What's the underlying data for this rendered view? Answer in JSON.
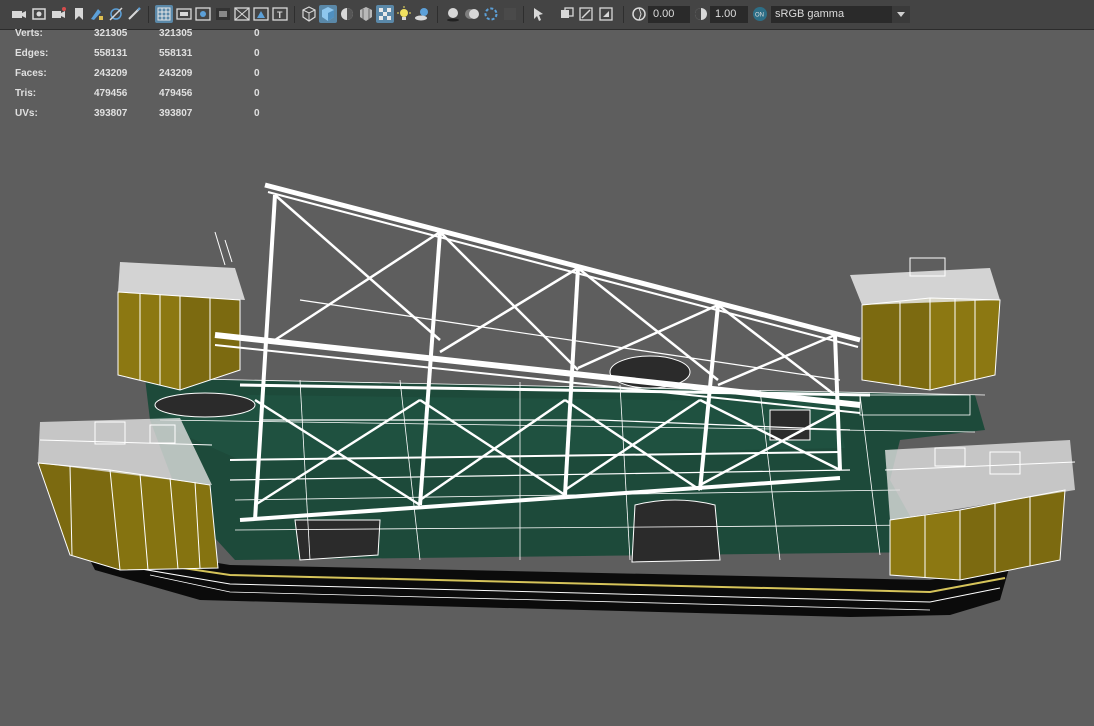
{
  "toolbar": {
    "icons": [
      "camera-icon",
      "camera-lock-icon",
      "camera-attributes-icon",
      "bookmark-icon",
      "image-plane-icon",
      "grease-pencil-icon",
      "2d-pan-zoom-icon",
      "grid-icon",
      "film-gate-icon",
      "resolution-gate-icon",
      "gate-mask-icon",
      "field-chart-icon",
      "safe-title-icon",
      "wireframe-icon",
      "smooth-shade-icon",
      "default-lighting-icon",
      "textured-icon",
      "wireframe-on-shaded-icon",
      "use-all-lights-icon",
      "shadows-icon",
      "ambient-occlusion-icon",
      "motion-blur-icon",
      "anti-aliasing-icon",
      "isolate-select-icon",
      "xray-icon",
      "xray-joints-icon",
      "xray-active-components-icon",
      "exposure-icon",
      "gamma-icon",
      "color-management-icon"
    ],
    "exposure_value": "0.00",
    "gamma_value": "1.00",
    "color_space": "sRGB gamma",
    "dropdown_icon": "chevron-down-icon",
    "colors": {
      "bar": "#444444",
      "field": "#2a2a2a",
      "active": "#5a88a8"
    }
  },
  "hud": {
    "rows": [
      {
        "label": "Verts:",
        "v1": "321305",
        "v2": "321305",
        "v3": "0"
      },
      {
        "label": "Edges:",
        "v1": "558131",
        "v2": "558131",
        "v3": "0"
      },
      {
        "label": "Faces:",
        "v1": "243209",
        "v2": "243209",
        "v3": "0"
      },
      {
        "label": "Tris:",
        "v1": "479456",
        "v2": "479456",
        "v3": "0"
      },
      {
        "label": "UVs:",
        "v1": "393807",
        "v2": "393807",
        "v3": "0"
      }
    ]
  },
  "viewport": {
    "background": "#5e5e5e",
    "colors": {
      "deck": "#1d4a3a",
      "tower": "#7c6a10",
      "hull": "#0b0b0b",
      "wire": "#ffffff",
      "trim": "#d6c45a",
      "hatch": "#2b2b2b"
    }
  }
}
